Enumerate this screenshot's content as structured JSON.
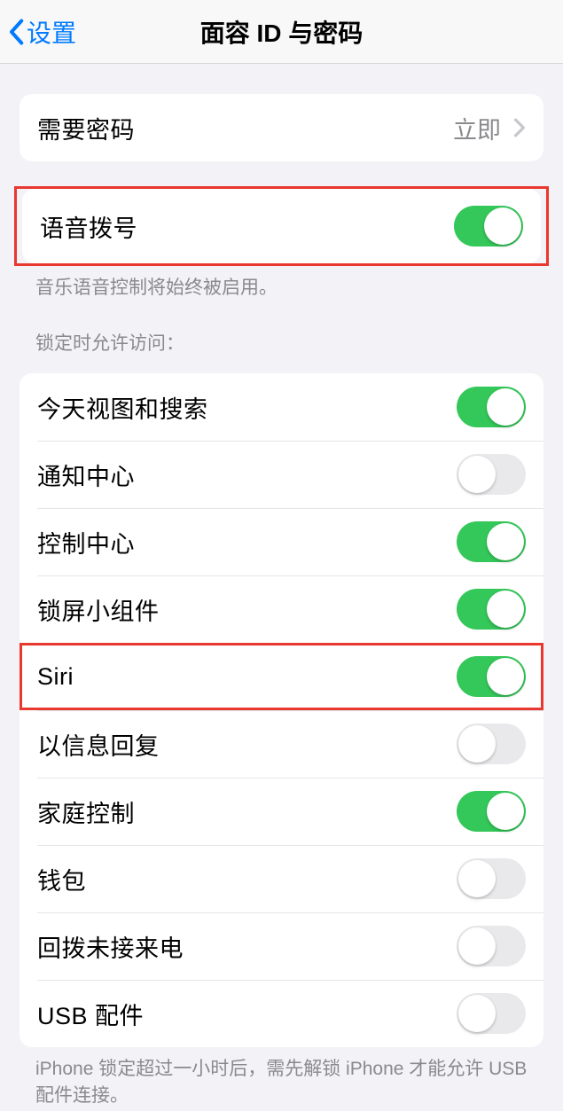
{
  "nav": {
    "back": "设置",
    "title": "面容 ID 与密码"
  },
  "require_passcode": {
    "label": "需要密码",
    "value": "立即"
  },
  "voice_dial": {
    "label": "语音拨号",
    "on": true,
    "footer": "音乐语音控制将始终被启用。"
  },
  "locked_access": {
    "header": "锁定时允许访问：",
    "items": [
      {
        "label": "今天视图和搜索",
        "on": true,
        "highlight": false
      },
      {
        "label": "通知中心",
        "on": false,
        "highlight": false
      },
      {
        "label": "控制中心",
        "on": true,
        "highlight": false
      },
      {
        "label": "锁屏小组件",
        "on": true,
        "highlight": false
      },
      {
        "label": "Siri",
        "on": true,
        "highlight": true
      },
      {
        "label": "以信息回复",
        "on": false,
        "highlight": false
      },
      {
        "label": "家庭控制",
        "on": true,
        "highlight": false
      },
      {
        "label": "钱包",
        "on": false,
        "highlight": false
      },
      {
        "label": "回拨未接来电",
        "on": false,
        "highlight": false
      },
      {
        "label": "USB 配件",
        "on": false,
        "highlight": false
      }
    ],
    "footer": "iPhone 锁定超过一小时后，需先解锁 iPhone 才能允许 USB 配件连接。"
  }
}
